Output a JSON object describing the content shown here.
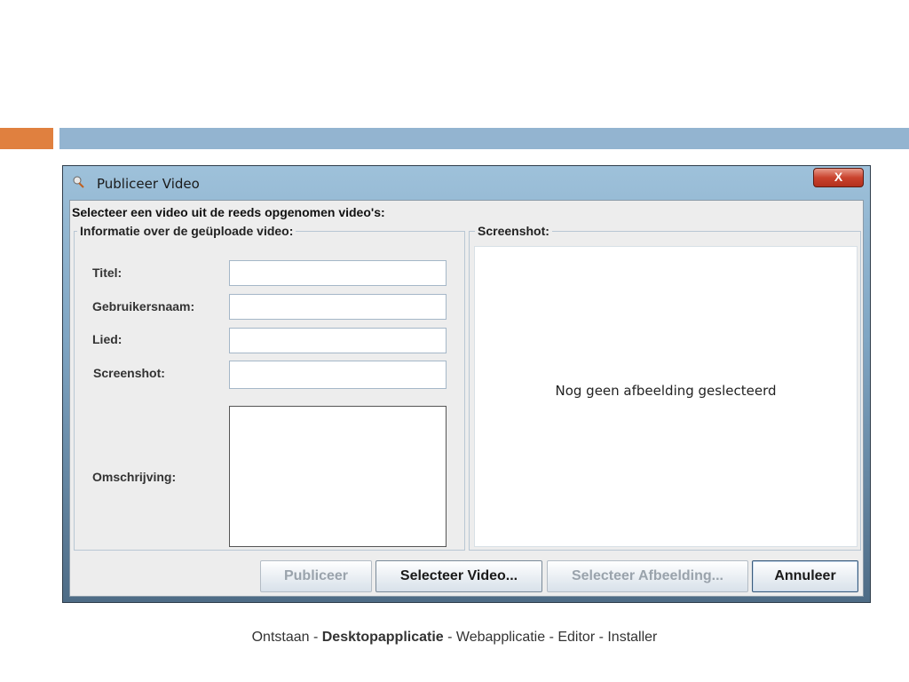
{
  "window": {
    "title": "Publiceer Video",
    "close_label": "X",
    "intro": "Selecteer een video uit de reeds opgenomen video's:"
  },
  "info_group": {
    "legend": "Informatie over de geüploade video:",
    "fields": [
      {
        "label": "Titel:",
        "value": ""
      },
      {
        "label": "Gebruikersnaam:",
        "value": ""
      },
      {
        "label": "Lied:",
        "value": ""
      },
      {
        "label": "Screenshot:",
        "value": ""
      }
    ],
    "description_label": "Omschrijving:",
    "description_value": ""
  },
  "screenshot_group": {
    "legend": "Screenshot:",
    "placeholder": "Nog geen afbeelding geslecteerd"
  },
  "buttons": {
    "publish": "Publiceer",
    "select_video": "Selecteer Video...",
    "select_image": "Selecteer Afbeelding...",
    "cancel": "Annuleer"
  },
  "footer": {
    "item1": "Ontstaan",
    "sep": " - ",
    "item2": "Desktopapplicatie",
    "item3": "Webapplicatie",
    "item4": "Editor",
    "item5": "Installer"
  },
  "colors": {
    "accent_orange": "#e0803f",
    "accent_blue": "#93b4d0"
  }
}
